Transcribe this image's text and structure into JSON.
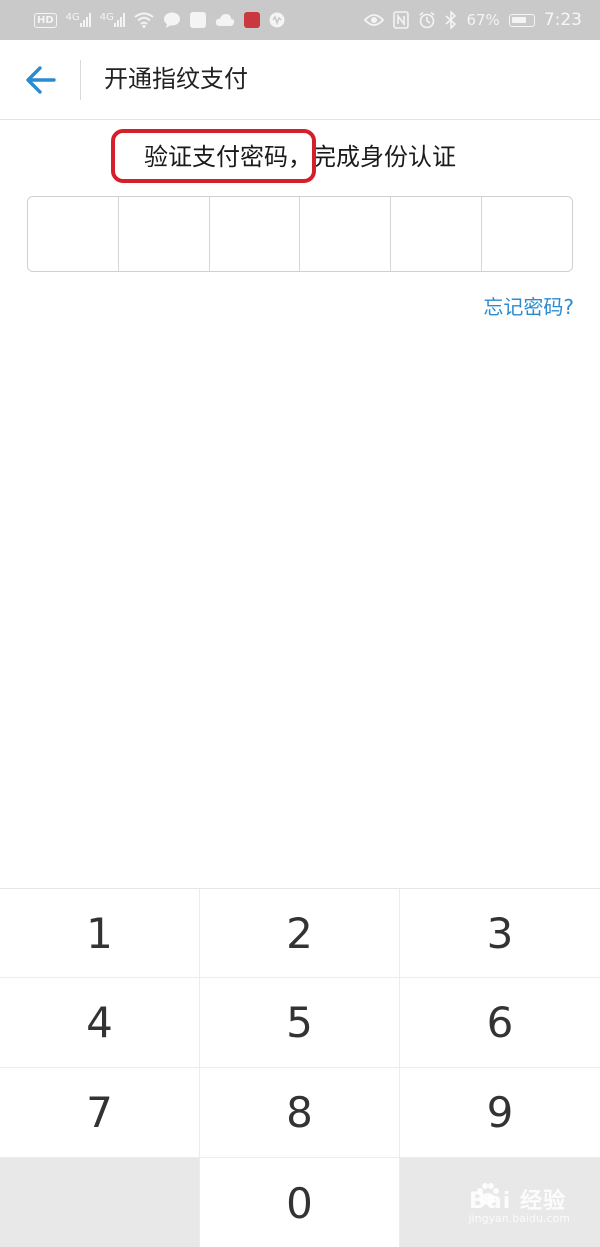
{
  "status_bar": {
    "hd_badge": "HD",
    "signal1": "4G",
    "signal2": "4G",
    "battery_percent": "67%",
    "time": "7:23"
  },
  "header": {
    "title": "开通指纹支付"
  },
  "prompt": {
    "text": "验证支付密码，完成身份认证"
  },
  "pin": {
    "cell_count": 6
  },
  "forgot_link": "忘记密码?",
  "keypad": {
    "keys": [
      "1",
      "2",
      "3",
      "4",
      "5",
      "6",
      "7",
      "8",
      "9",
      "",
      "0",
      ""
    ]
  },
  "watermark": {
    "text": "Bai 经验",
    "sub": "jingyan.baidu.com"
  },
  "colors": {
    "accent": "#2b8bd0",
    "highlight": "#d4202a",
    "status_bar": "#c9c9c9"
  }
}
